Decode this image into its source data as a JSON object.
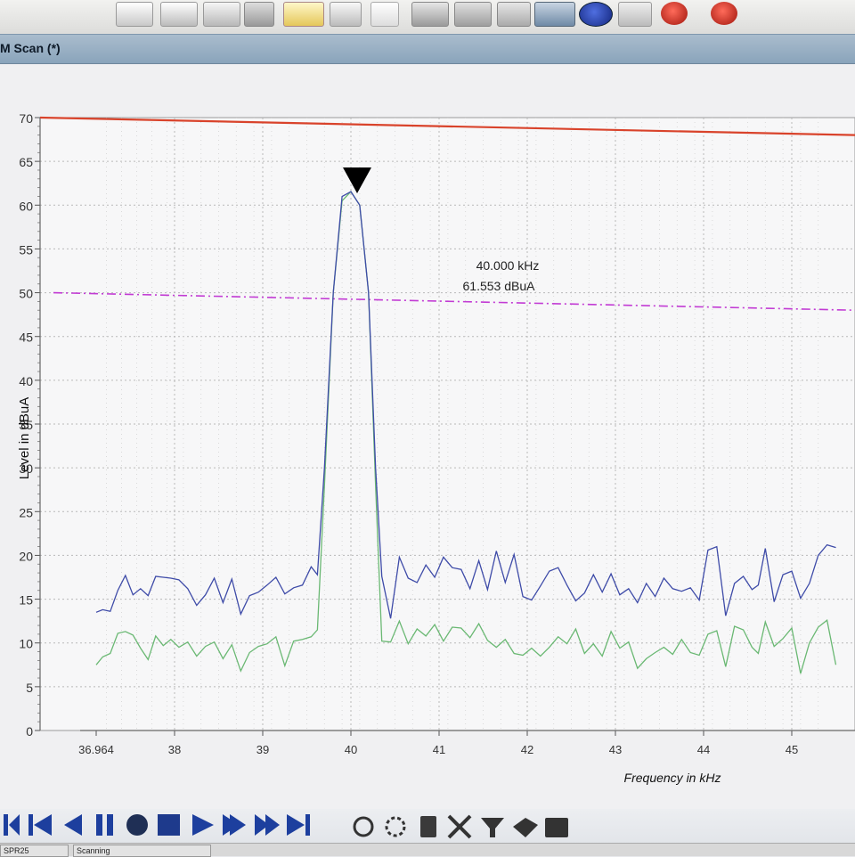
{
  "window": {
    "title": "M Scan (*)"
  },
  "toolbar": {
    "icons": [
      "new-icon",
      "open-icon",
      "print-icon",
      "export-icon",
      "edit-icon",
      "database-icon",
      "save-db-icon",
      "delete-db-icon",
      "screenshot-icon",
      "info-icon",
      "wrench-icon",
      "marker-1-icon",
      "marker-2-icon"
    ]
  },
  "colors": {
    "limit_line": "#d9432b",
    "margin_line": "#c23bd4",
    "peak_trace": "#3e4ba8",
    "average_trace": "#6ab873",
    "marker": "#000000",
    "grid": "#b9b9b9"
  },
  "chart_data": {
    "type": "line",
    "ylabel": "Level in dBuA",
    "xlabel": "Frequency in kHz",
    "ylim": [
      0,
      70
    ],
    "xlim": [
      36.964,
      45.5
    ],
    "y_ticks": [
      "0",
      "5",
      "10",
      "15",
      "20",
      "25",
      "30",
      "35",
      "40",
      "45",
      "50",
      "55",
      "60",
      "65",
      "70"
    ],
    "x_ticks": [
      {
        "value": 36.964,
        "label": "36.964"
      },
      {
        "value": 38,
        "label": "38"
      },
      {
        "value": 39,
        "label": "39"
      },
      {
        "value": 40,
        "label": "40"
      },
      {
        "value": 41,
        "label": "41"
      },
      {
        "value": 42,
        "label": "42"
      },
      {
        "value": 43,
        "label": "43"
      },
      {
        "value": 44,
        "label": "44"
      },
      {
        "value": 45,
        "label": "45"
      }
    ],
    "grid": true,
    "limit_line": {
      "start": 70,
      "end": 68
    },
    "margin_line": {
      "start": 50,
      "end": 48
    },
    "marker": {
      "x": 40.0,
      "y": 61.553,
      "label_freq": "40.000 kHz",
      "label_level": "61.553 dBuA"
    },
    "series": [
      {
        "key": "peak",
        "x": [
          36.964,
          37.05,
          37.15,
          37.25,
          37.35,
          37.45,
          37.55,
          37.65,
          37.75,
          37.85,
          37.95,
          38.05,
          38.15,
          38.25,
          38.35,
          38.45,
          38.55,
          38.65,
          38.75,
          38.85,
          38.95,
          39.05,
          39.15,
          39.25,
          39.35,
          39.45,
          39.55,
          39.62,
          39.7,
          39.8,
          39.9,
          40.0,
          40.1,
          40.2,
          40.28,
          40.35,
          40.45,
          40.55,
          40.65,
          40.75,
          40.85,
          40.95,
          41.05,
          41.15,
          41.25,
          41.35,
          41.45,
          41.55,
          41.65,
          41.75,
          41.85,
          41.95,
          42.05,
          42.15,
          42.25,
          42.35,
          42.45,
          42.55,
          42.65,
          42.75,
          42.85,
          42.95,
          43.05,
          43.15,
          43.25,
          43.35,
          43.45,
          43.55,
          43.65,
          43.75,
          43.85,
          43.95,
          44.05,
          44.15,
          44.25,
          44.35,
          44.45,
          44.55,
          44.62,
          44.7,
          44.8,
          44.9,
          45.0,
          45.1,
          45.2,
          45.3,
          45.4,
          45.5
        ],
        "y": [
          13.5,
          13.8,
          13.6,
          16,
          17.7,
          15.5,
          16.2,
          15.4,
          17.6,
          17.5,
          17.4,
          17.2,
          16.2,
          14.3,
          15.5,
          17.4,
          14.6,
          17.3,
          13.3,
          15.4,
          15.8,
          16.6,
          17.5,
          15.6,
          16.3,
          16.6,
          18.7,
          17.8,
          30,
          50,
          61,
          61.55,
          60,
          50,
          30,
          17.6,
          12.8,
          19.8,
          17.4,
          16.9,
          18.9,
          17.5,
          19.8,
          18.6,
          18.4,
          16.2,
          19.4,
          16.1,
          20.5,
          16.9,
          20.1,
          15.3,
          14.9,
          16.5,
          18.2,
          18.6,
          16.6,
          14.8,
          15.7,
          17.8,
          15.8,
          17.9,
          15.5,
          16.2,
          14.6,
          16.8,
          15.3,
          17.4,
          16.2,
          15.9,
          16.3,
          14.9,
          20.6,
          21.0,
          13.1,
          16.8,
          17.6,
          16.1,
          16.6,
          20.8,
          14.7,
          17.8,
          18.2,
          15.1,
          16.8,
          20.0,
          21.2,
          20.9
        ]
      },
      {
        "key": "average",
        "x": [
          36.964,
          37.05,
          37.15,
          37.25,
          37.35,
          37.45,
          37.55,
          37.65,
          37.75,
          37.85,
          37.95,
          38.05,
          38.15,
          38.25,
          38.35,
          38.45,
          38.55,
          38.65,
          38.75,
          38.85,
          38.95,
          39.05,
          39.15,
          39.25,
          39.35,
          39.45,
          39.55,
          39.62,
          39.7,
          39.8,
          39.9,
          40.0,
          40.1,
          40.2,
          40.28,
          40.35,
          40.45,
          40.55,
          40.65,
          40.75,
          40.85,
          40.95,
          41.05,
          41.15,
          41.25,
          41.35,
          41.45,
          41.55,
          41.65,
          41.75,
          41.85,
          41.95,
          42.05,
          42.15,
          42.25,
          42.35,
          42.45,
          42.55,
          42.65,
          42.75,
          42.85,
          42.95,
          43.05,
          43.15,
          43.25,
          43.35,
          43.45,
          43.55,
          43.65,
          43.75,
          43.85,
          43.95,
          44.05,
          44.15,
          44.25,
          44.35,
          44.45,
          44.55,
          44.62,
          44.7,
          44.8,
          44.9,
          45.0,
          45.1,
          45.2,
          45.3,
          45.4,
          45.5
        ],
        "y": [
          7.5,
          8.4,
          8.8,
          11.1,
          11.3,
          10.9,
          9.4,
          8.1,
          10.8,
          9.7,
          10.4,
          9.5,
          10.1,
          8.5,
          9.6,
          10.1,
          8.2,
          9.8,
          6.8,
          8.9,
          9.6,
          9.9,
          10.7,
          7.4,
          10.2,
          10.4,
          10.7,
          11.5,
          28,
          50,
          60.5,
          61.55,
          60,
          50,
          28,
          10.2,
          10.1,
          12.5,
          9.9,
          11.6,
          10.8,
          12.1,
          10.2,
          11.8,
          11.7,
          10.6,
          12.2,
          10.3,
          9.5,
          10.4,
          8.8,
          8.6,
          9.4,
          8.5,
          9.5,
          10.7,
          9.9,
          11.6,
          8.8,
          9.9,
          8.5,
          11.3,
          9.4,
          10.1,
          7.1,
          8.2,
          8.9,
          9.5,
          8.7,
          10.4,
          8.9,
          8.6,
          11.0,
          11.4,
          7.3,
          11.9,
          11.5,
          9.5,
          8.8,
          12.4,
          9.6,
          10.5,
          11.7,
          6.5,
          10.0,
          11.8,
          12.6,
          7.5
        ]
      }
    ]
  },
  "transport": {
    "icons": [
      "skip-start-icon",
      "step-back-icon",
      "rewind-icon",
      "pause-icon",
      "record-icon",
      "stop-icon",
      "play-icon",
      "step-forward-icon",
      "fast-forward-icon",
      "skip-end-icon",
      "refresh-icon",
      "loop-icon",
      "battery-icon",
      "clear-icon",
      "antenna-icon",
      "satellite-icon",
      "camera-icon"
    ]
  },
  "status": {
    "device": "SPR25",
    "state": "Scanning"
  }
}
